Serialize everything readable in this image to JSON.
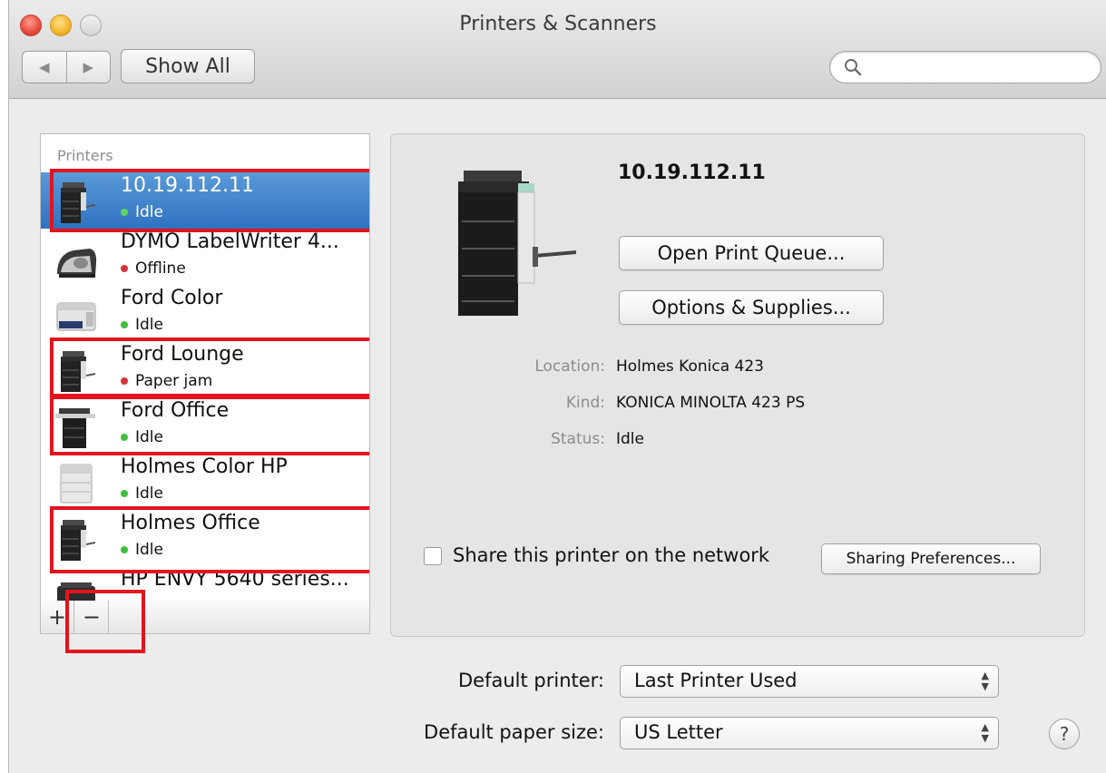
{
  "window": {
    "title": "Printers & Scanners"
  },
  "toolbar": {
    "back_icon": "◀",
    "forward_icon": "▶",
    "show_all_label": "Show All",
    "search_value": "",
    "search_placeholder": ""
  },
  "printer_list": {
    "header": "Printers",
    "items": [
      {
        "name": "10.19.112.11",
        "status": "Idle",
        "status_color": "#3fbf3f",
        "icon": "copier-icon",
        "selected": true,
        "highlighted": true
      },
      {
        "name": "DYMO LabelWriter 4...",
        "status": "Offline",
        "status_color": "#d8333b",
        "icon": "label-printer-icon",
        "selected": false,
        "highlighted": false
      },
      {
        "name": "Ford Color",
        "status": "Idle",
        "status_color": "#3fbf3f",
        "icon": "laser-printer-icon",
        "selected": false,
        "highlighted": false
      },
      {
        "name": "Ford Lounge",
        "status": "Paper jam",
        "status_color": "#d8333b",
        "icon": "copier-icon",
        "selected": false,
        "highlighted": true
      },
      {
        "name": "Ford Office",
        "status": "Idle",
        "status_color": "#3fbf3f",
        "icon": "copier-icon",
        "selected": false,
        "highlighted": true
      },
      {
        "name": "Holmes Color HP",
        "status": "Idle",
        "status_color": "#3fbf3f",
        "icon": "laser-printer-icon",
        "selected": false,
        "highlighted": false
      },
      {
        "name": "Holmes Office",
        "status": "Idle",
        "status_color": "#3fbf3f",
        "icon": "copier-icon",
        "selected": false,
        "highlighted": true
      },
      {
        "name": "HP ENVY 5640 series...",
        "status": "",
        "status_color": "#3fbf3f",
        "icon": "inkjet-printer-icon",
        "selected": false,
        "highlighted": false
      }
    ],
    "add_label": "+",
    "remove_label": "−",
    "highlight_color": "#e3141d"
  },
  "detail": {
    "printer_name": "10.19.112.11",
    "open_queue_label": "Open Print Queue...",
    "options_label": "Options & Supplies...",
    "location_label": "Location:",
    "location_value": "Holmes Konica 423",
    "kind_label": "Kind:",
    "kind_value": "KONICA MINOLTA 423 PS",
    "status_label": "Status:",
    "status_value": "Idle",
    "share_label": "Share this printer on the network",
    "share_checked": false,
    "sharing_prefs_label": "Sharing Preferences..."
  },
  "bottom": {
    "default_printer_label": "Default printer:",
    "default_printer_value": "Last Printer Used",
    "paper_size_label": "Default paper size:",
    "paper_size_value": "US Letter",
    "help_label": "?"
  }
}
